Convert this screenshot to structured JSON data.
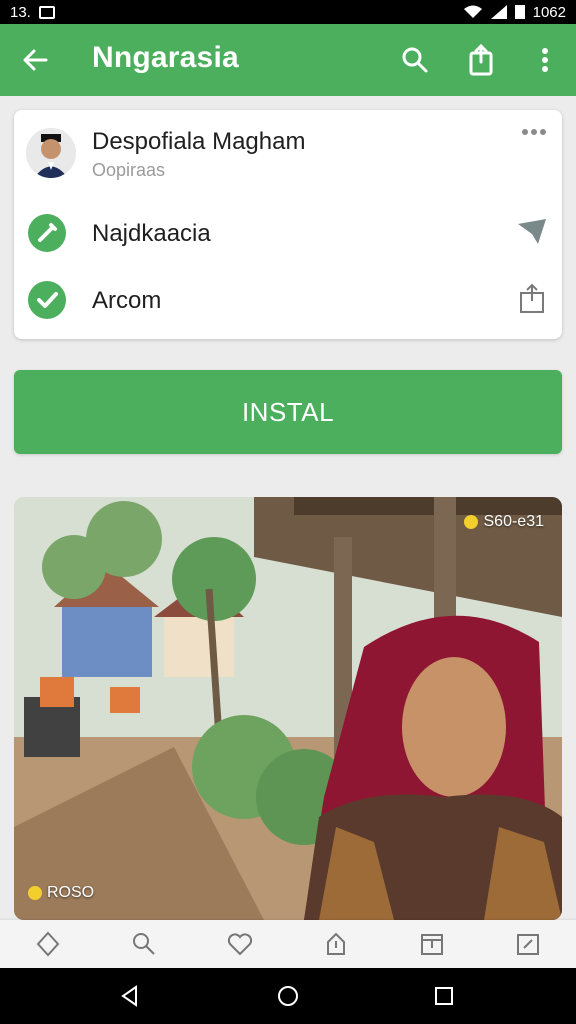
{
  "status_bar": {
    "time": "13.",
    "clock": "1062"
  },
  "app_bar": {
    "title": "Nngarasia"
  },
  "profile": {
    "name": "Despofiala Magham",
    "subtitle": "Oopiraas"
  },
  "rows": [
    {
      "label": "Najdkaacia",
      "right_icon": "send-icon"
    },
    {
      "label": "Arcom",
      "right_icon": "share-icon"
    }
  ],
  "install_button": {
    "label": "INSTAL"
  },
  "photo": {
    "top_right_text": "S60-e31",
    "bottom_left_text": "ROSO"
  },
  "bottom_nav": [
    "home-icon",
    "search-icon",
    "heart-icon",
    "upload-icon",
    "calendar-icon",
    "edit-icon"
  ],
  "system_nav": [
    "back-triangle-icon",
    "home-circle-icon",
    "recents-square-icon"
  ],
  "colors": {
    "primary": "#4caf5d",
    "background": "#ececec"
  }
}
